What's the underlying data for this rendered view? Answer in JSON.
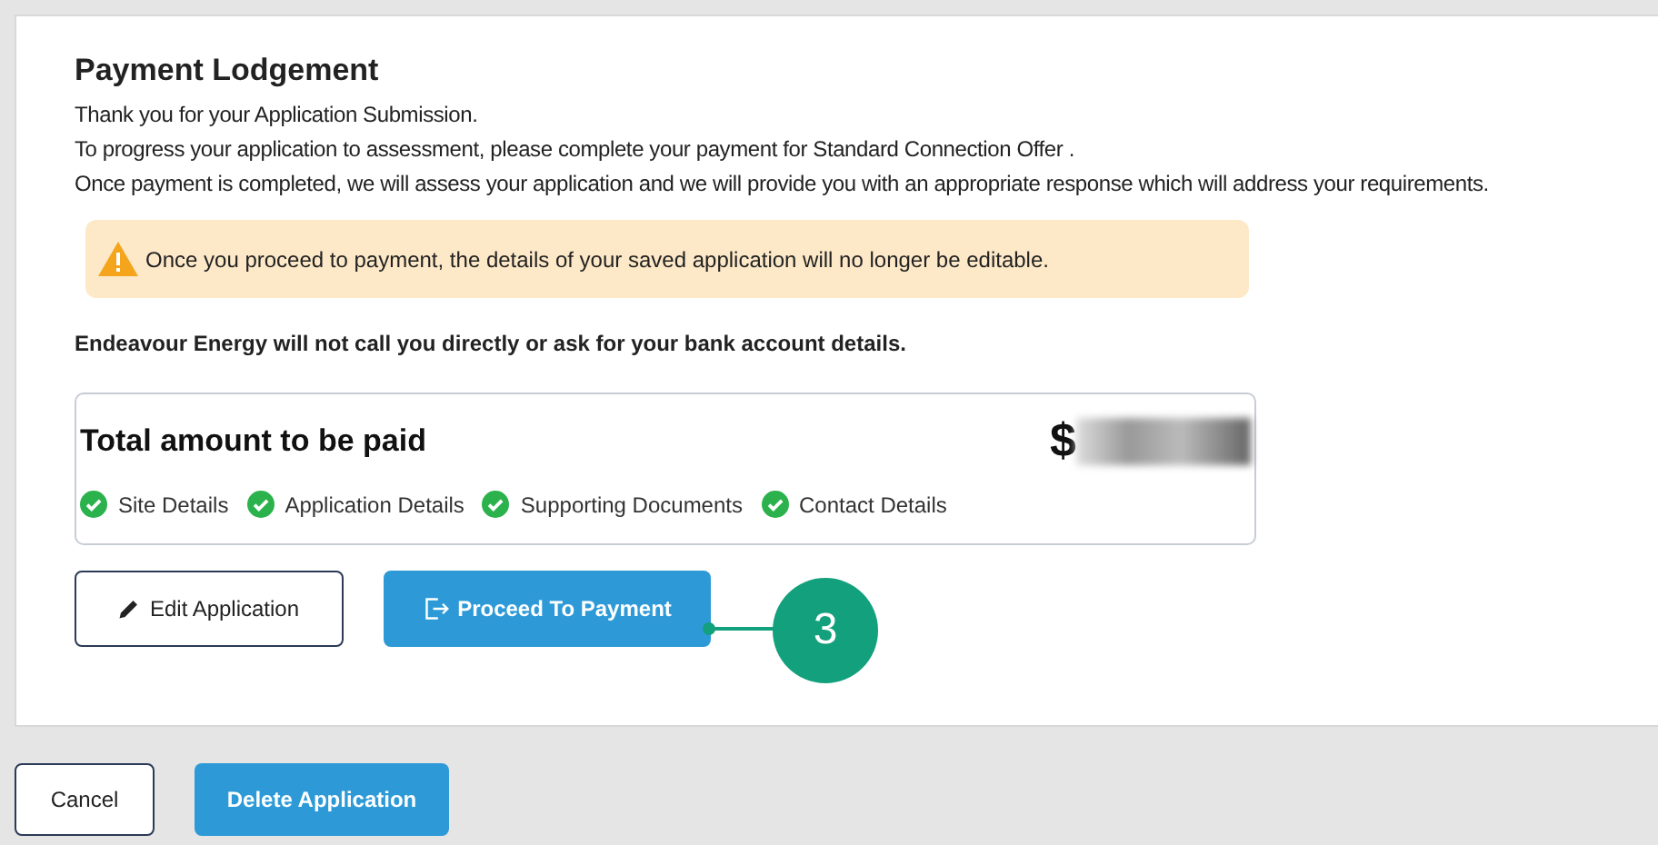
{
  "title": "Payment Lodgement",
  "intro_lines": [
    "Thank you for your Application Submission.",
    "To progress your application to assessment, please complete your payment for Standard Connection Offer .",
    "Once payment is completed, we will assess your application and we will provide you with an appropriate response which will address your requirements."
  ],
  "warning": "Once you proceed to payment, the details of your saved application will no longer be editable.",
  "notice": "Endeavour Energy will not call you directly or ask for your bank account details.",
  "summary": {
    "label": "Total amount to be paid",
    "amount": "$",
    "steps": [
      {
        "label": "Site Details",
        "checked": true
      },
      {
        "label": "Application Details",
        "checked": true
      },
      {
        "label": "Supporting Documents",
        "checked": true
      },
      {
        "label": "Contact Details",
        "checked": true
      }
    ]
  },
  "actions": [
    {
      "label": "Edit Application",
      "kind": "outline"
    },
    {
      "label": "Proceed To Payment",
      "kind": "primary"
    }
  ],
  "callout": "3",
  "footer_buttons": [
    {
      "label": "Cancel",
      "kind": "outline"
    },
    {
      "label": "Delete Application",
      "kind": "primary"
    }
  ]
}
